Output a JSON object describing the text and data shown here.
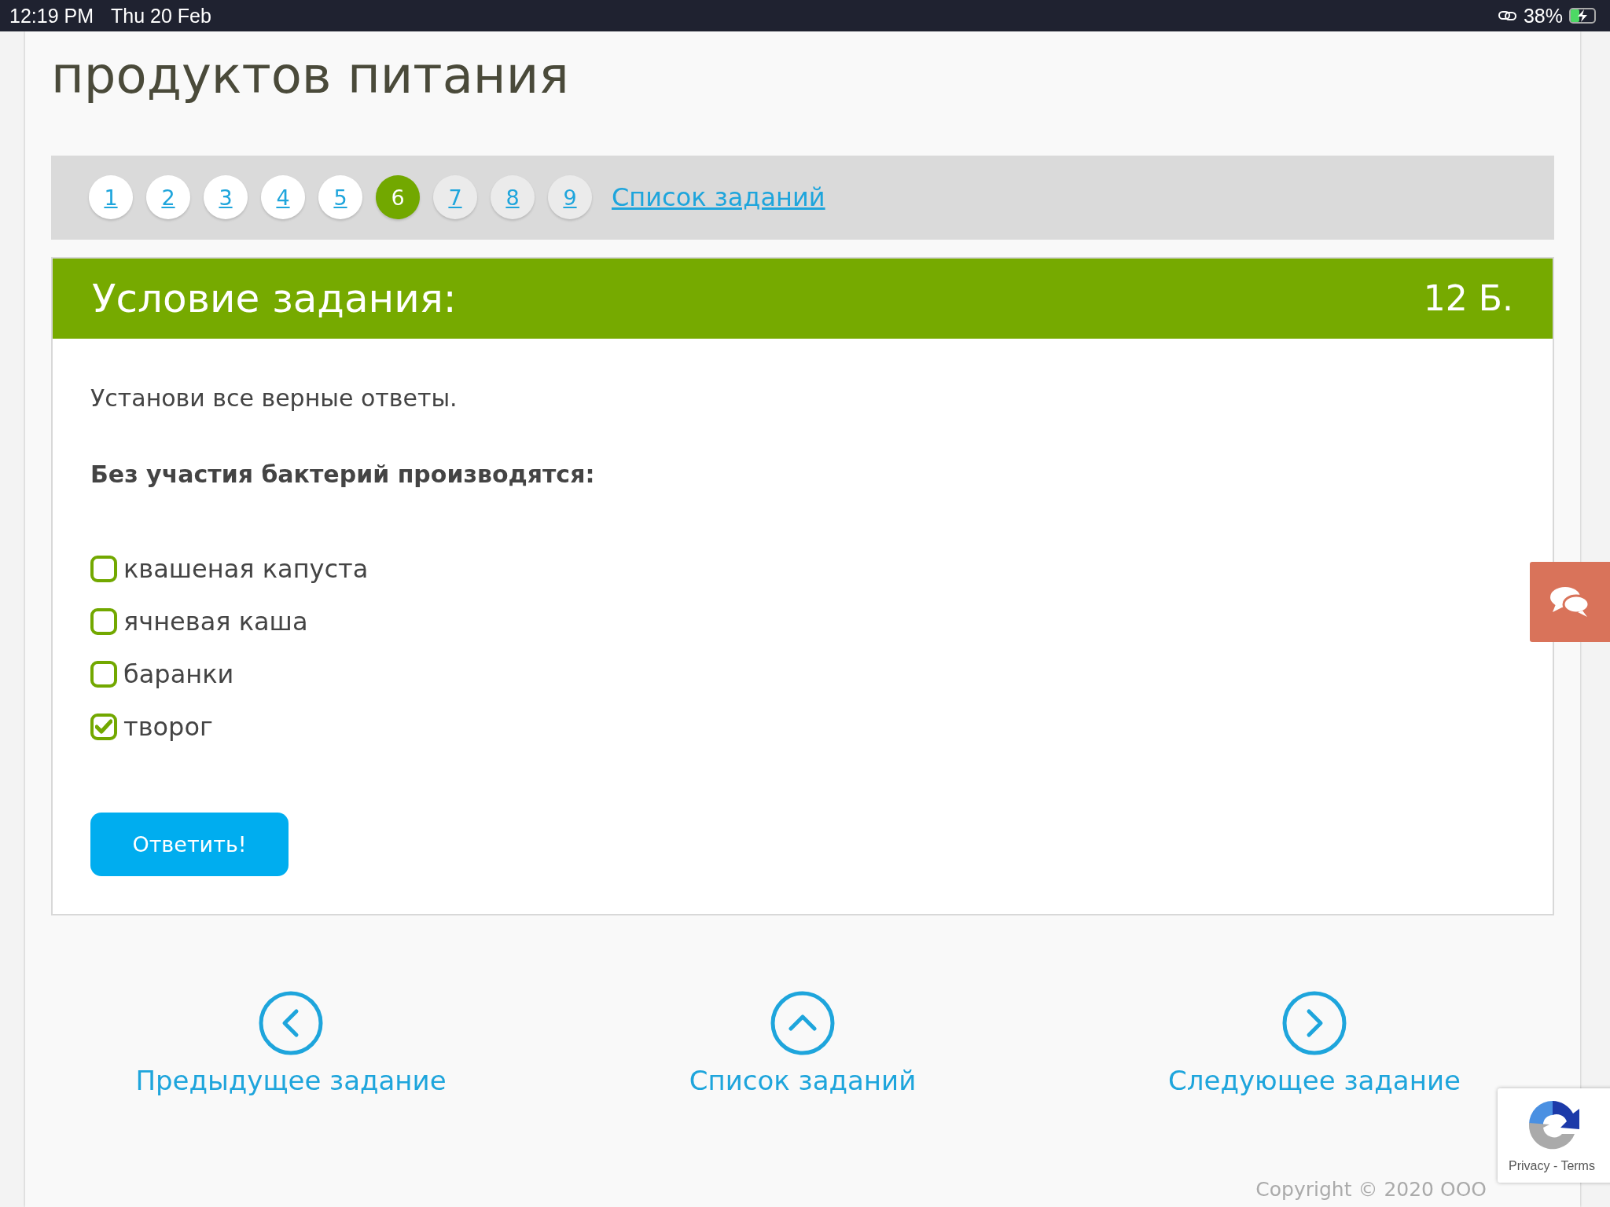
{
  "status_bar": {
    "time": "12:19 PM",
    "date": "Thu 20 Feb",
    "battery": "38%",
    "charging": true,
    "level": 0.38
  },
  "title": "продуктов питания",
  "pagination": {
    "pages": [
      {
        "label": "1",
        "selected": false,
        "visited": true
      },
      {
        "label": "2",
        "selected": false,
        "visited": true
      },
      {
        "label": "3",
        "selected": false,
        "visited": true
      },
      {
        "label": "4",
        "selected": false,
        "visited": true
      },
      {
        "label": "5",
        "selected": false,
        "visited": true
      },
      {
        "label": "6",
        "selected": true,
        "visited": false
      },
      {
        "label": "7",
        "selected": false,
        "visited": false
      },
      {
        "label": "8",
        "selected": false,
        "visited": false
      },
      {
        "label": "9",
        "selected": false,
        "visited": false
      }
    ],
    "list_link": "Список заданий"
  },
  "task": {
    "header": "Условие задания:",
    "points": "12 Б.",
    "instruction": "Установи все верные ответы.",
    "question": "Без участия бактерий производятся:",
    "options": [
      {
        "label": "квашеная капуста",
        "checked": false
      },
      {
        "label": "ячневая каша",
        "checked": false
      },
      {
        "label": "баранки",
        "checked": false
      },
      {
        "label": "творог",
        "checked": true
      }
    ],
    "submit": "Ответить!"
  },
  "bottom_nav": [
    {
      "kind": "prev",
      "label": "Предыдущее задание"
    },
    {
      "kind": "up",
      "label": "Список заданий"
    },
    {
      "kind": "next",
      "label": "Следующее задание"
    }
  ],
  "copyright": "Copyright © 2020 ООО",
  "recaptcha": {
    "links": "Privacy - Terms"
  }
}
